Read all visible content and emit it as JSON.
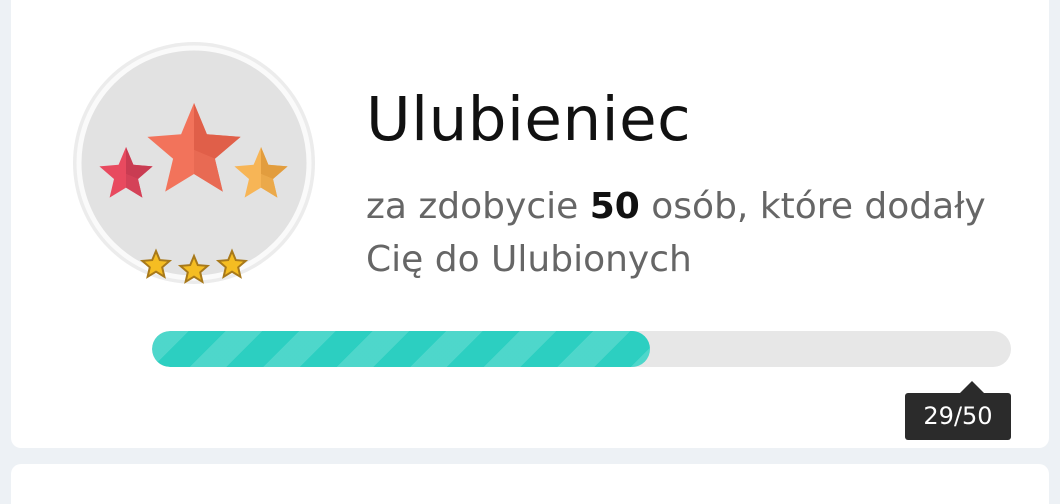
{
  "achievement": {
    "title": "Ulubieniec",
    "description_prefix": "za zdobycie ",
    "description_count": "50",
    "description_suffix": " osób, które dodały Cię do Ulubionych",
    "badge_icon": "three-stars-badge-icon",
    "level_icon": "three-small-gold-stars-icon",
    "level_stars": 3
  },
  "progress": {
    "current": 29,
    "target": 50,
    "label": "29/50"
  },
  "colors": {
    "progress_fill": "#2ccfc1",
    "progress_track": "#e7e7e7",
    "tooltip_bg": "#2b2b2b",
    "star_center": "#f2735b",
    "star_left": "#e84a5f",
    "star_right": "#f7b556",
    "level_star": "#f5bd22"
  }
}
